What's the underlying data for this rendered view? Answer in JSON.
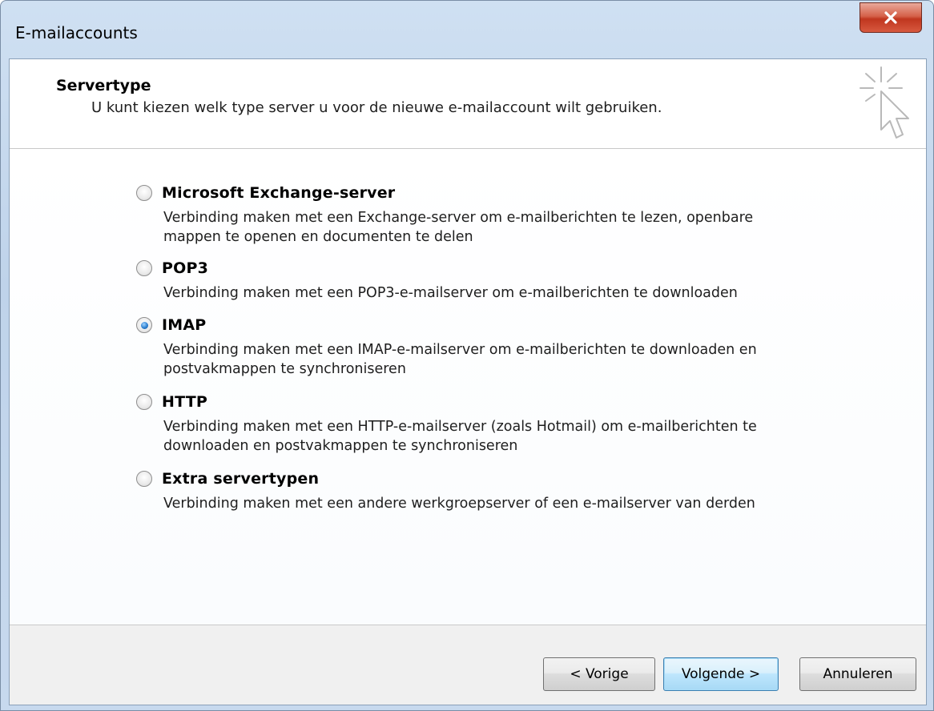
{
  "window": {
    "title": "E-mailaccounts",
    "close_icon": "close-icon"
  },
  "header": {
    "title": "Servertype",
    "subtitle": "U kunt kiezen welk type server u voor de nieuwe e-mailaccount wilt gebruiken.",
    "icon": "cursor-click-icon"
  },
  "options": [
    {
      "label": "Microsoft Exchange-server",
      "description": "Verbinding maken met een Exchange-server om e-mailberichten te lezen, openbare mappen te openen en documenten te delen",
      "checked": false
    },
    {
      "label": "POP3",
      "description": "Verbinding maken met een POP3-e-mailserver om e-mailberichten te downloaden",
      "checked": false
    },
    {
      "label": "IMAP",
      "description": "Verbinding maken met een IMAP-e-mailserver om e-mailberichten te downloaden en postvakmappen te synchroniseren",
      "checked": true
    },
    {
      "label": "HTTP",
      "description": "Verbinding maken met een HTTP-e-mailserver (zoals Hotmail) om e-mailberichten te downloaden en postvakmappen te synchroniseren",
      "checked": false
    },
    {
      "label": "Extra servertypen",
      "description": "Verbinding maken met een andere werkgroepserver of een e-mailserver van derden",
      "checked": false
    }
  ],
  "buttons": {
    "back": "< Vorige",
    "next": "Volgende >",
    "cancel": "Annuleren"
  },
  "colors": {
    "close_button": "#c8442c",
    "frame": "#c7d9ee",
    "default_button_border": "#3c7fb1"
  }
}
